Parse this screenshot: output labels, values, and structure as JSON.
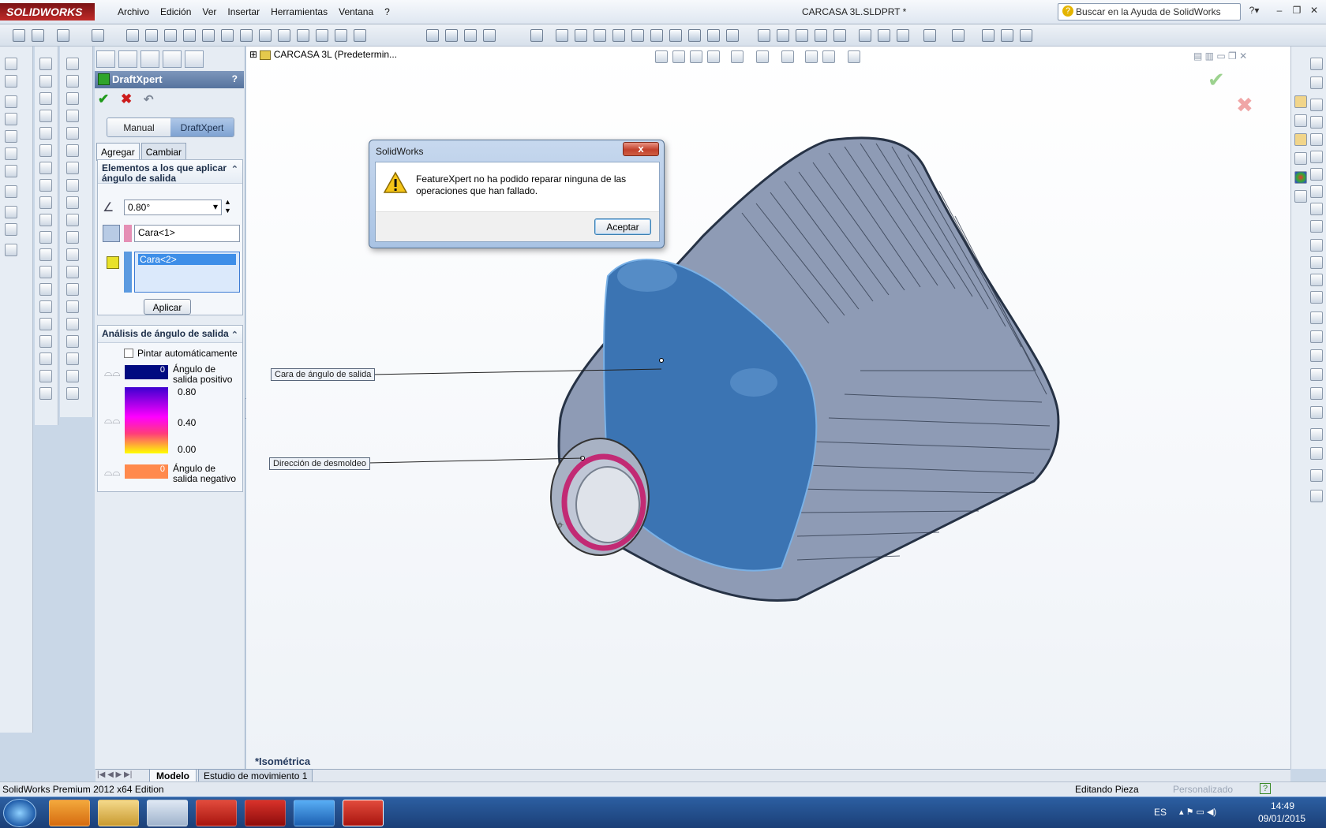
{
  "app": {
    "logo": "SOLIDWORKS",
    "title": "CARCASA 3L.SLDPRT *"
  },
  "menu": [
    "Archivo",
    "Edición",
    "Ver",
    "Insertar",
    "Herramientas",
    "Ventana",
    "?"
  ],
  "search": {
    "placeholder": "Buscar en la Ayuda de SolidWorks"
  },
  "tree": {
    "label": "CARCASA 3L  (Predetermin..."
  },
  "propertymanager": {
    "title": "DraftXpert",
    "help": "?",
    "modes": {
      "manual": "Manual",
      "draftxpert": "DraftXpert"
    },
    "tabs": {
      "add": "Agregar",
      "change": "Cambiar"
    },
    "items_group": {
      "title": "Elementos a los que aplicar ángulo de salida",
      "angle": "0.80°",
      "neutral_face": "Cara<1>",
      "faces": [
        "Cara<2>"
      ],
      "apply": "Aplicar"
    },
    "analysis_group": {
      "title": "Análisis de ángulo de salida",
      "auto_paint": "Pintar automáticamente",
      "positive_value": "0",
      "positive_label": "Ángulo de salida positivo",
      "scale": [
        "0.80",
        "0.40",
        "0.00"
      ],
      "negative_value": "0",
      "negative_label": "Ángulo de salida negativo"
    }
  },
  "callouts": {
    "face": "Cara de ángulo de salida",
    "direction": "Dirección de desmoldeo"
  },
  "view": {
    "orientation": "*Isométrica"
  },
  "dialog": {
    "title": "SolidWorks",
    "message": "FeatureXpert no ha podido reparar ninguna de las operaciones que han fallado.",
    "ok": "Aceptar",
    "close": "x"
  },
  "feature_tabs": [
    "Modelo",
    "Estudio de movimiento 1"
  ],
  "status": {
    "left": "SolidWorks Premium 2012 x64 Edition",
    "mode": "Editando Pieza",
    "custom": "Personalizado"
  },
  "taskbar": {
    "lang": "ES",
    "time": "14:49",
    "date": "09/01/2015"
  },
  "colors": {
    "model_blue": "#3b74b3",
    "draft_gray": "#8e9bb5",
    "neutral_pink": "#e58fb5",
    "positive": "#000a80",
    "negative": "#ff8a4d"
  }
}
